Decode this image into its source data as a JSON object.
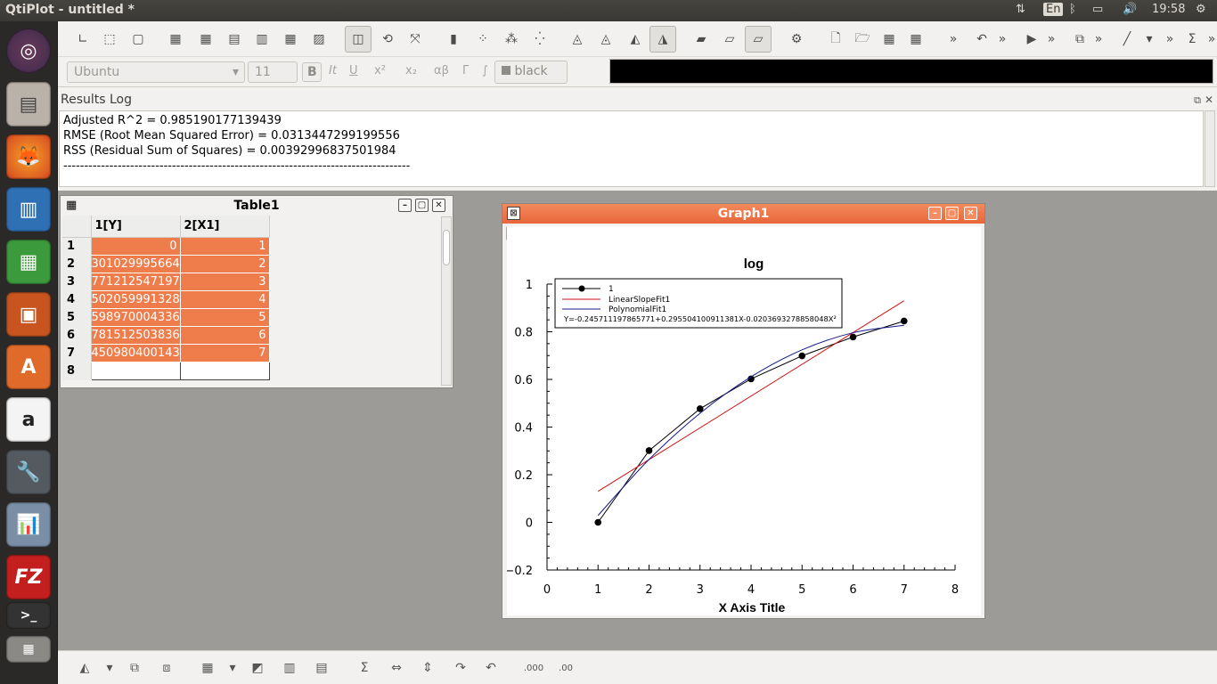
{
  "window_title": "QtiPlot - untitled *",
  "system": {
    "keyboard": "En",
    "time": "19:58"
  },
  "font_toolbar": {
    "font": "Ubuntu",
    "size": "11",
    "bold": "B",
    "italic": "It",
    "underline": "U",
    "superscript": "x²",
    "subscript": "x₂",
    "greek": "αβ",
    "greek_upper": "Γ",
    "integral": "∫",
    "color_label": "black"
  },
  "results_log": {
    "title": "Results Log",
    "lines": [
      "Adjusted R^2 = 0.985190177139439",
      "RMSE (Root Mean Squared Error) = 0.0313447299199556",
      "RSS (Residual Sum of Squares) = 0.00392996837501984",
      "------------------------------------------------------------------------------------"
    ]
  },
  "table": {
    "title": "Table1",
    "columns": [
      "1[Y]",
      "2[X1]"
    ],
    "rows": [
      {
        "n": "1",
        "y": "0",
        "x": "1"
      },
      {
        "n": "2",
        "y": "301029995664",
        "x": "2"
      },
      {
        "n": "3",
        "y": "771212547197",
        "x": "3"
      },
      {
        "n": "4",
        "y": "502059991328",
        "x": "4"
      },
      {
        "n": "5",
        "y": "598970004336",
        "x": "5"
      },
      {
        "n": "6",
        "y": "781512503836",
        "x": "6"
      },
      {
        "n": "7",
        "y": "450980400143",
        "x": "7"
      },
      {
        "n": "8",
        "y": "",
        "x": ""
      }
    ]
  },
  "graph": {
    "title": "Graph1",
    "layer_button": "1",
    "plot_title": "log",
    "legend": {
      "series1": "1",
      "linear": "LinearSlopeFit1",
      "poly": "PolynomialFit1",
      "equation": "Y=-0.245711197865771+0.295504100911381X-0.0203693278858048X²"
    }
  },
  "chart_data": {
    "type": "scatter",
    "title": "log",
    "xlabel": "X Axis Title",
    "ylabel": "",
    "xlim": [
      0,
      8
    ],
    "ylim": [
      -0.2,
      1
    ],
    "x_ticks": [
      "0",
      "1",
      "2",
      "3",
      "4",
      "5",
      "6",
      "7",
      "8"
    ],
    "y_ticks": [
      "1",
      "0.8",
      "0.6",
      "0.4",
      "0.2",
      "0",
      "−0.2"
    ],
    "legend_position": "top-left",
    "series": [
      {
        "name": "1",
        "kind": "points+line",
        "color": "#000000",
        "x": [
          1,
          2,
          3,
          4,
          5,
          6,
          7
        ],
        "y": [
          0,
          0.301,
          0.477,
          0.602,
          0.699,
          0.778,
          0.845
        ]
      },
      {
        "name": "LinearSlopeFit1",
        "kind": "line",
        "color": "#d01010",
        "x": [
          1,
          7
        ],
        "y": [
          0.13,
          0.93
        ]
      },
      {
        "name": "PolynomialFit1",
        "kind": "curve",
        "color": "#1a1a8c",
        "x": [
          1,
          2,
          3,
          4,
          5,
          6,
          7
        ],
        "y": [
          0.029,
          0.264,
          0.458,
          0.611,
          0.724,
          0.796,
          0.827
        ]
      }
    ]
  },
  "colors": {
    "accent": "#ef7d4c",
    "titlebar": "#ee6c3c",
    "window_bg": "#f2f1f0"
  }
}
